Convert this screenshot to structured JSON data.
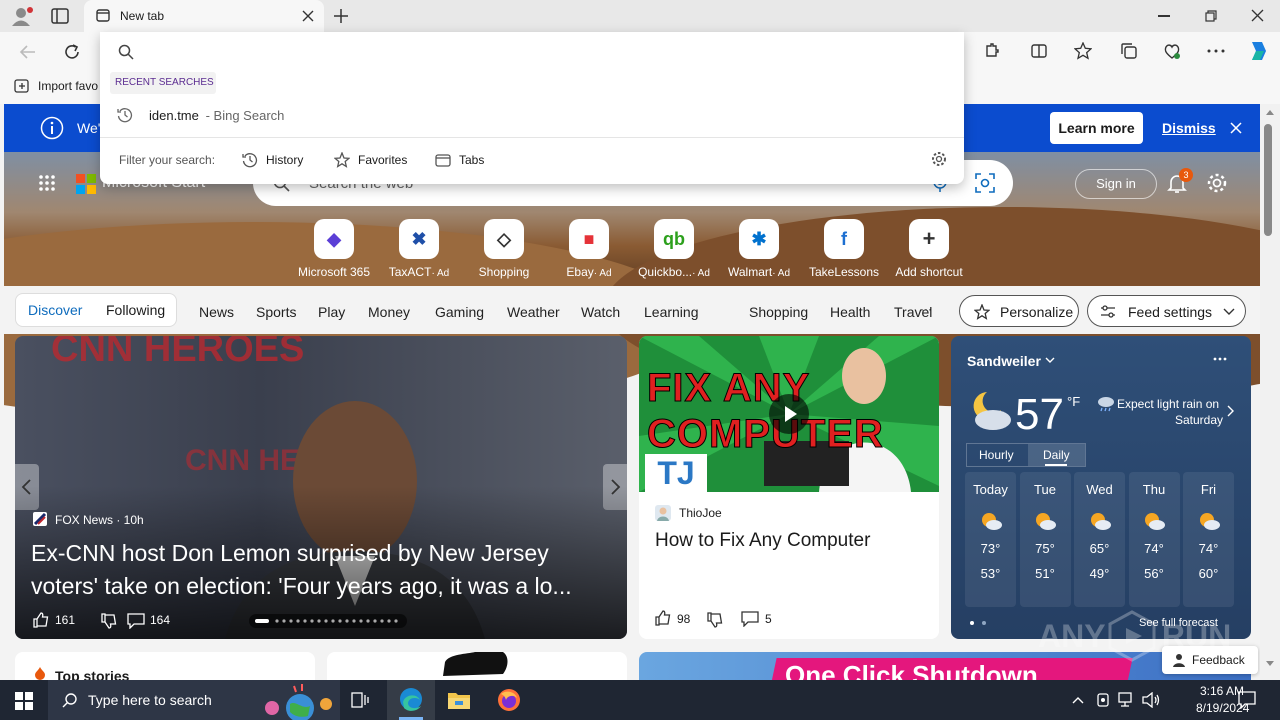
{
  "browser": {
    "tab_title": "New tab",
    "favorites_bar": {
      "import_label": "Import favo"
    }
  },
  "omnibox": {
    "recent_header": "RECENT SEARCHES",
    "recent_item": "iden.tme",
    "recent_item_suffix": " - Bing Search",
    "filter_label": "Filter your search:",
    "filters": [
      "History",
      "Favorites",
      "Tabs"
    ]
  },
  "infobar": {
    "text": "We'",
    "learn_more": "Learn more",
    "dismiss": "Dismiss"
  },
  "header": {
    "brand": "Microsoft Start",
    "search_placeholder": "Search the web",
    "sign_in": "Sign in",
    "notification_count": "3"
  },
  "quick_links": [
    {
      "label": "Microsoft 365",
      "ad": ""
    },
    {
      "label": "TaxACT",
      "ad": "· Ad"
    },
    {
      "label": "Shopping",
      "ad": ""
    },
    {
      "label": "Ebay",
      "ad": "· Ad"
    },
    {
      "label": "Quickbo...",
      "ad": "· Ad"
    },
    {
      "label": "Walmart",
      "ad": "· Ad"
    },
    {
      "label": "TakeLessons",
      "ad": ""
    },
    {
      "label": "Add shortcut",
      "ad": ""
    }
  ],
  "nav": {
    "discover": "Discover",
    "following": "Following",
    "items": [
      "News",
      "Sports",
      "Play",
      "Money",
      "Gaming",
      "Weather",
      "Watch",
      "Learning",
      "Shopping",
      "Health",
      "Travel"
    ],
    "more": "···",
    "personalize": "Personalize",
    "feed_settings": "Feed settings"
  },
  "main_story": {
    "source": "FOX News · 10h",
    "headline_line1": "Ex-CNN host Don Lemon surprised by New Jersey",
    "headline_line2": "voters' take on election: 'Four years ago, it was a lo...",
    "likes": "161",
    "comments": "164",
    "bg_text_top": "CNN HEROES",
    "bg_text_side": "CNN HERO"
  },
  "video_card": {
    "thumb_line1": "FIX ANY",
    "thumb_line2": "COMPUTER",
    "thumb_tag": "TJ",
    "source": "ThioJoe",
    "title": "How to Fix Any Computer",
    "likes": "98",
    "comments": "5"
  },
  "weather": {
    "location": "Sandweiler",
    "temp": "57",
    "unit": "°F",
    "forecast_line1": "Expect light rain on",
    "forecast_line2": "Saturday",
    "tab_hourly": "Hourly",
    "tab_daily": "Daily",
    "days": [
      {
        "name": "Today",
        "hi": "73°",
        "lo": "53°"
      },
      {
        "name": "Tue",
        "hi": "75°",
        "lo": "51°"
      },
      {
        "name": "Wed",
        "hi": "65°",
        "lo": "49°"
      },
      {
        "name": "Thu",
        "hi": "74°",
        "lo": "56°"
      },
      {
        "name": "Fri",
        "hi": "74°",
        "lo": "60°"
      }
    ],
    "see_full": "See full forecast"
  },
  "bottom": {
    "top_stories": "Top stories",
    "feedback": "Feedback",
    "promo_text": "One Click Shutdown"
  },
  "watermark": "ANY RUN",
  "taskbar": {
    "search_placeholder": "Type here to search",
    "time": "3:16 AM",
    "date": "8/19/2024"
  },
  "colors": {
    "infobar": "#0b4ccf",
    "accent": "#0f6cbd",
    "taskbar": "#1f2633"
  }
}
